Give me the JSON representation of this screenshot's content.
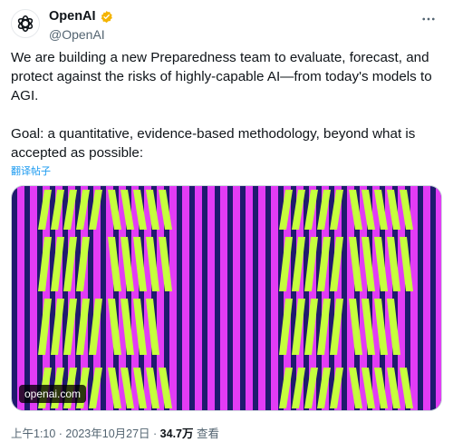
{
  "tweet": {
    "name": "OpenAI",
    "handle": "@OpenAI",
    "paragraph1": "We are building a new Preparedness team to evaluate, forecast, and protect against the risks of highly-capable AI—from today's models to AGI.",
    "paragraph2": "Goal: a quantitative, evidence-based methodology, beyond what is accepted as possible:",
    "translate_label": "翻译帖子",
    "media_source": "openai.com",
    "timestamp": "上午1:10 · 2023年10月27日",
    "separator": " · ",
    "views_count": "34.7万",
    "views_label": " 查看"
  },
  "colors": {
    "verified_badge": "#f4b400",
    "link": "#1d9bf0",
    "image_background": "#1f1a6e",
    "image_stripe": "#e23cf5",
    "image_accent": "#c6ff3d"
  },
  "icons": {
    "avatar": "openai-logo-icon",
    "verified": "verified-badge-icon",
    "more": "more-options-icon"
  }
}
